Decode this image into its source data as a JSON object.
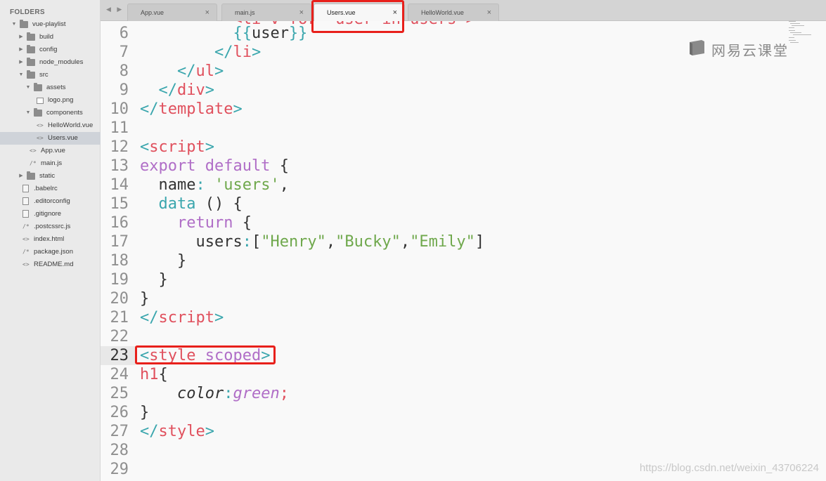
{
  "sidebar": {
    "header": "FOLDERS",
    "tree": [
      {
        "label": "vue-playlist",
        "kind": "folder",
        "depth": 0,
        "expanded": true
      },
      {
        "label": "build",
        "kind": "folder",
        "depth": 1,
        "expanded": false
      },
      {
        "label": "config",
        "kind": "folder",
        "depth": 1,
        "expanded": false
      },
      {
        "label": "node_modules",
        "kind": "folder",
        "depth": 1,
        "expanded": false
      },
      {
        "label": "src",
        "kind": "folder",
        "depth": 1,
        "expanded": true
      },
      {
        "label": "assets",
        "kind": "folder",
        "depth": 2,
        "expanded": true
      },
      {
        "label": "logo.png",
        "kind": "image",
        "depth": 3
      },
      {
        "label": "components",
        "kind": "folder",
        "depth": 2,
        "expanded": true
      },
      {
        "label": "HelloWorld.vue",
        "kind": "code",
        "depth": 3
      },
      {
        "label": "Users.vue",
        "kind": "code",
        "depth": 3,
        "selected": true
      },
      {
        "label": "App.vue",
        "kind": "code",
        "depth": 2
      },
      {
        "label": "main.js",
        "kind": "js",
        "depth": 2
      },
      {
        "label": "static",
        "kind": "folder",
        "depth": 1,
        "expanded": false
      },
      {
        "label": ".babelrc",
        "kind": "file",
        "depth": 1
      },
      {
        "label": ".editorconfig",
        "kind": "file",
        "depth": 1
      },
      {
        "label": ".gitignore",
        "kind": "file",
        "depth": 1
      },
      {
        "label": ".postcssrc.js",
        "kind": "js",
        "depth": 1
      },
      {
        "label": "index.html",
        "kind": "code",
        "depth": 1
      },
      {
        "label": "package.json",
        "kind": "js",
        "depth": 1
      },
      {
        "label": "README.md",
        "kind": "code",
        "depth": 1
      }
    ]
  },
  "tabs": {
    "nav": "◀ ▶",
    "items": [
      {
        "label": "App.vue",
        "close": "×"
      },
      {
        "label": "main.js",
        "close": "×"
      },
      {
        "label": "Users.vue",
        "close": "×",
        "active": true
      },
      {
        "label": "HelloWorld.vue",
        "close": "×"
      }
    ]
  },
  "editor": {
    "current_line": 23,
    "partial_top_line": "          <li v-for=\"user in users\">",
    "lines": [
      {
        "n": "6",
        "tokens": [
          [
            "plain",
            "          "
          ],
          [
            "t-mus",
            "{{"
          ],
          [
            "plain",
            "user"
          ],
          [
            "t-mus",
            "}}"
          ]
        ]
      },
      {
        "n": "7",
        "tokens": [
          [
            "plain",
            "        "
          ],
          [
            "t-br",
            "</"
          ],
          [
            "t-tag",
            "li"
          ],
          [
            "t-br",
            ">"
          ]
        ]
      },
      {
        "n": "8",
        "tokens": [
          [
            "plain",
            "    "
          ],
          [
            "t-br",
            "</"
          ],
          [
            "t-tag",
            "ul"
          ],
          [
            "t-br",
            ">"
          ]
        ]
      },
      {
        "n": "9",
        "tokens": [
          [
            "plain",
            "  "
          ],
          [
            "t-br",
            "</"
          ],
          [
            "t-tag",
            "div"
          ],
          [
            "t-br",
            ">"
          ]
        ]
      },
      {
        "n": "10",
        "tokens": [
          [
            "t-br",
            "</"
          ],
          [
            "t-tag",
            "template"
          ],
          [
            "t-br",
            ">"
          ]
        ]
      },
      {
        "n": "11",
        "tokens": []
      },
      {
        "n": "12",
        "tokens": [
          [
            "t-br",
            "<"
          ],
          [
            "t-tag",
            "script"
          ],
          [
            "t-br",
            ">"
          ]
        ]
      },
      {
        "n": "13",
        "tokens": [
          [
            "t-kw",
            "export default "
          ],
          [
            "plain",
            "{"
          ]
        ]
      },
      {
        "n": "14",
        "tokens": [
          [
            "plain",
            "  name"
          ],
          [
            "t-br",
            ":"
          ],
          [
            "plain",
            " "
          ],
          [
            "t-str",
            "'users'"
          ],
          [
            "plain",
            ","
          ]
        ]
      },
      {
        "n": "15",
        "tokens": [
          [
            "plain",
            "  "
          ],
          [
            "t-fn",
            "data"
          ],
          [
            "plain",
            " () {"
          ]
        ]
      },
      {
        "n": "16",
        "tokens": [
          [
            "plain",
            "    "
          ],
          [
            "t-kw",
            "return"
          ],
          [
            "plain",
            " {"
          ]
        ]
      },
      {
        "n": "17",
        "tokens": [
          [
            "plain",
            "      users"
          ],
          [
            "t-br",
            ":"
          ],
          [
            "plain",
            "["
          ],
          [
            "t-str",
            "\"Henry\""
          ],
          [
            "plain",
            ","
          ],
          [
            "t-str",
            "\"Bucky\""
          ],
          [
            "plain",
            ","
          ],
          [
            "t-str",
            "\"Emily\""
          ],
          [
            "plain",
            "]"
          ]
        ]
      },
      {
        "n": "18",
        "tokens": [
          [
            "plain",
            "    }"
          ]
        ]
      },
      {
        "n": "19",
        "tokens": [
          [
            "plain",
            "  }"
          ]
        ]
      },
      {
        "n": "20",
        "tokens": [
          [
            "plain",
            "}"
          ]
        ]
      },
      {
        "n": "21",
        "tokens": [
          [
            "t-br",
            "</"
          ],
          [
            "t-tag",
            "script"
          ],
          [
            "t-br",
            ">"
          ]
        ]
      },
      {
        "n": "22",
        "tokens": []
      },
      {
        "n": "23",
        "tokens": [
          [
            "t-br",
            "<"
          ],
          [
            "t-tag",
            "style"
          ],
          [
            "plain",
            " "
          ],
          [
            "t-attr",
            "scoped"
          ],
          [
            "t-br",
            ">"
          ]
        ]
      },
      {
        "n": "24",
        "tokens": [
          [
            "t-tag",
            "h1"
          ],
          [
            "plain",
            "{"
          ]
        ]
      },
      {
        "n": "25",
        "tokens": [
          [
            "plain",
            "    "
          ],
          [
            "t-prop",
            "color"
          ],
          [
            "t-br",
            ":"
          ],
          [
            "t-val",
            "green"
          ],
          [
            "t-tag",
            ";"
          ]
        ]
      },
      {
        "n": "26",
        "tokens": [
          [
            "plain",
            "}"
          ]
        ]
      },
      {
        "n": "27",
        "tokens": [
          [
            "t-br",
            "</"
          ],
          [
            "t-tag",
            "style"
          ],
          [
            "t-br",
            ">"
          ]
        ]
      },
      {
        "n": "28",
        "tokens": []
      },
      {
        "n": "29",
        "tokens": []
      }
    ]
  },
  "watermark": {
    "logo_text": "网易云课堂",
    "url": "https://blog.csdn.net/weixin_43706224"
  },
  "colors": {
    "tag": "#e0505d",
    "bracket": "#3aa6ad",
    "keyword": "#b06ec7",
    "string": "#6fa84c",
    "annotation": "#e8201b"
  }
}
